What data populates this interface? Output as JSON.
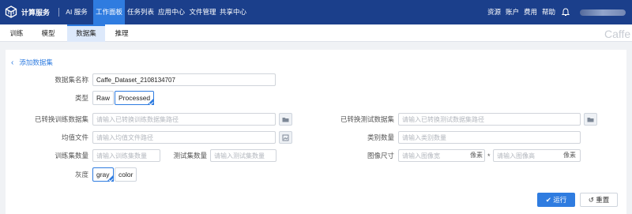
{
  "topnav": {
    "brand": "计算服务",
    "items": [
      "AI 服务",
      "工作面板",
      "任务列表",
      "应用中心",
      "文件管理",
      "共享中心"
    ],
    "right_links": [
      "资源",
      "账户",
      "费用",
      "帮助"
    ]
  },
  "tabs": [
    "训练",
    "模型",
    "数据集",
    "推理"
  ],
  "watermark": "Caffe",
  "form": {
    "back_label": "添加数据集",
    "name_label": "数据集名称",
    "name_value": "Caffe_Dataset_2108134707",
    "type_label": "类型",
    "type_options": [
      "Raw",
      "Processed"
    ],
    "type_selected": "Processed",
    "train_set_label": "已转换训练数据集",
    "train_set_placeholder": "请输入已转换训练数据集路径",
    "test_set_label": "已转换测试数据集",
    "test_set_placeholder": "请输入已转换测试数据集路径",
    "mean_file_label": "均值文件",
    "mean_file_placeholder": "请输入均值文件路径",
    "class_count_label": "类别数量",
    "class_count_placeholder": "请输入类别数量",
    "train_count_label": "训练集数量",
    "train_count_placeholder": "请输入训练集数量",
    "test_count_label": "测试集数量",
    "test_count_placeholder": "请输入测试集数量",
    "image_size_label": "图像尺寸",
    "image_width_placeholder": "请输入图像宽",
    "image_height_placeholder": "请输入图像高",
    "pixel_unit": "像素",
    "times_sign": "*",
    "gray_label": "灰度",
    "gray_options": [
      "gray",
      "color"
    ],
    "gray_selected": "gray"
  },
  "actions": {
    "run": "运行",
    "reset": "重置"
  },
  "colors": {
    "nav_bg": "#1b3f8b",
    "accent": "#2f7ce0"
  }
}
